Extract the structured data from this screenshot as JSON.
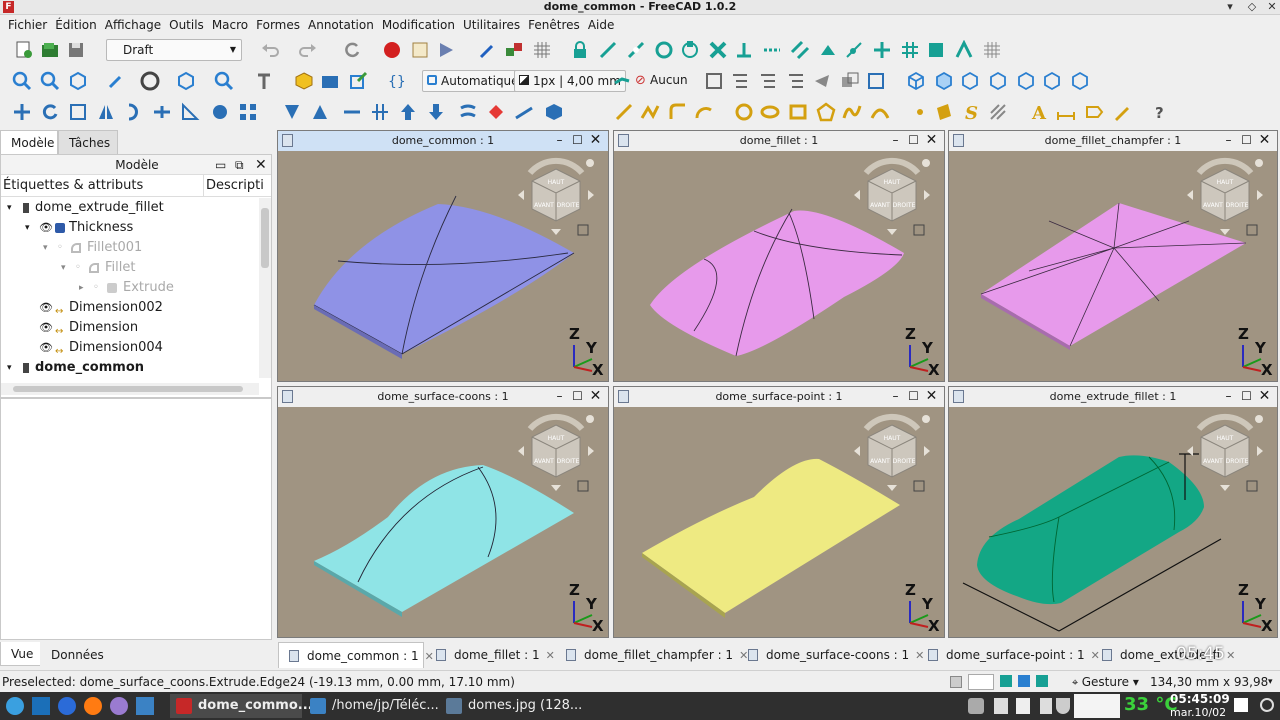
{
  "window": {
    "title": "dome_common - FreeCAD 1.0.2"
  },
  "menu": [
    "Fichier",
    "Édition",
    "Affichage",
    "Outils",
    "Macro",
    "Formes",
    "Annotation",
    "Modification",
    "Utilitaires",
    "Fenêtres",
    "Aide"
  ],
  "toolbar": {
    "workbench": "Draft",
    "auto_label": "Automatique",
    "line_label": "1px | 4,00 mm",
    "none_label": "Aucun"
  },
  "left_panel": {
    "tabs": [
      "Modèle",
      "Tâches"
    ],
    "subheader": "Modèle",
    "columns": [
      "Étiquettes & attributs",
      "Descripti"
    ],
    "tree": [
      {
        "label": "dome_extrude_fillet",
        "style": "normal"
      },
      {
        "label": "Thickness",
        "style": "normal"
      },
      {
        "label": "Fillet001",
        "style": "dim"
      },
      {
        "label": "Fillet",
        "style": "dim"
      },
      {
        "label": "Extrude",
        "style": "dim"
      },
      {
        "label": "Dimension002",
        "style": "normal"
      },
      {
        "label": "Dimension",
        "style": "normal"
      },
      {
        "label": "Dimension004",
        "style": "normal"
      },
      {
        "label": "dome_common",
        "style": "bold"
      }
    ],
    "bottom_tabs": [
      "Vue",
      "Données"
    ]
  },
  "views": [
    {
      "title": "dome_common : 1",
      "color": "#8f92e6"
    },
    {
      "title": "dome_fillet : 1",
      "color": "#e79aeb"
    },
    {
      "title": "dome_fillet_champfer : 1",
      "color": "#e79aeb"
    },
    {
      "title": "dome_surface-coons : 1",
      "color": "#8fe4e6"
    },
    {
      "title": "dome_surface-point : 1",
      "color": "#eeea82"
    },
    {
      "title": "dome_extrude_fillet : 1",
      "color": "#13a785"
    }
  ],
  "navcube": {
    "top": "HAUT",
    "front": "AVANT",
    "right": "DROITE"
  },
  "axes": {
    "z": "Z",
    "y": "Y",
    "x": "X"
  },
  "doc_tabs": [
    "dome_common : 1",
    "dome_fillet : 1",
    "dome_fillet_champfer : 1",
    "dome_surface-coons : 1",
    "dome_surface-point : 1",
    "dome_extrude_fi"
  ],
  "overlay_time": "05:45",
  "status": {
    "preselected": "Preselected: dome_surface_coons.Extrude.Edge24 (-19.13 mm, 0.00 mm, 17.10 mm)",
    "nav_style": "Gesture",
    "dimensions": "134,30 mm x 93,98 mm"
  },
  "taskbar": {
    "tasks": [
      "dome_commo...",
      "/home/jp/Téléc...",
      "domes.jpg (128..."
    ],
    "temp": "33 °C",
    "time": "05:45:09",
    "date": "mar.10/02"
  }
}
